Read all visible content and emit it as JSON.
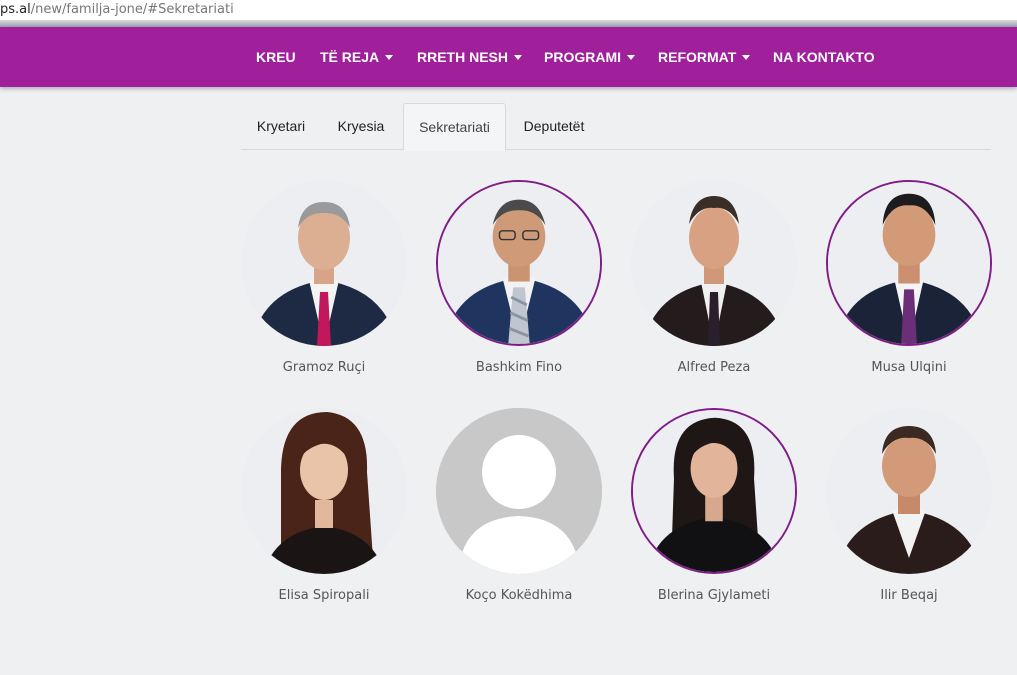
{
  "browser": {
    "url_domain": "ps.al",
    "url_path": "/new/familja-jone/#Sekretariati"
  },
  "nav": {
    "items": [
      {
        "label": "KREU",
        "dropdown": false
      },
      {
        "label": "TË REJA",
        "dropdown": true
      },
      {
        "label": "RRETH NESH",
        "dropdown": true
      },
      {
        "label": "PROGRAMI",
        "dropdown": true
      },
      {
        "label": "REFORMAT",
        "dropdown": true
      },
      {
        "label": "NA KONTAKTO",
        "dropdown": false
      }
    ],
    "color": "#a01f9b"
  },
  "tabs": {
    "items": [
      "Kryetari",
      "Kryesia",
      "Sekretariati",
      "Deputetët"
    ],
    "active": "Sekretariati"
  },
  "members": [
    {
      "name": "Gramoz Ruçi",
      "photo": "portrait-man-gray-hair-red-tie"
    },
    {
      "name": "Bashkim Fino",
      "photo": "portrait-man-glasses-striped-tie"
    },
    {
      "name": "Alfred Peza",
      "photo": "portrait-man-dark-tie"
    },
    {
      "name": "Musa Ulqini",
      "photo": "portrait-man-purple-tie"
    },
    {
      "name": "Elisa Spiropali",
      "photo": "portrait-woman-curly-hair"
    },
    {
      "name": "Koço Kokëdhima",
      "photo": "placeholder-silhouette"
    },
    {
      "name": "Blerina Gjylameti",
      "photo": "portrait-woman-dark-hair"
    },
    {
      "name": "Ilir Beqaj",
      "photo": "portrait-man-open-collar"
    }
  ]
}
